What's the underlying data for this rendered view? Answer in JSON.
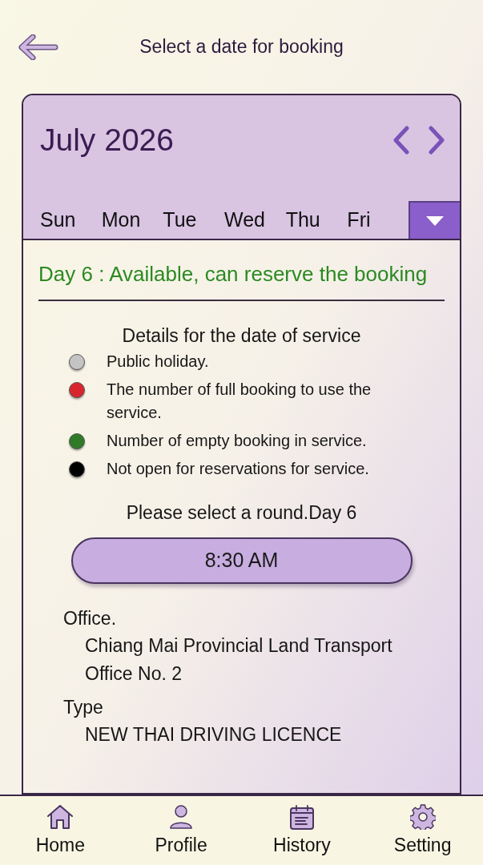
{
  "header": {
    "title": "Select a date for booking"
  },
  "calendar": {
    "month": "July 2026",
    "weekdays": [
      "Sun",
      "Mon",
      "Tue",
      "Wed",
      "Thu",
      "Fri"
    ]
  },
  "status": "Day 6 : Available, can reserve the booking",
  "legend": {
    "title": "Details for the date of service",
    "items": [
      {
        "label": "Public holiday.",
        "color": "#c4c4c4"
      },
      {
        "label": "The number of full booking to use the service.",
        "color": "#d8262e"
      },
      {
        "label": "Number of empty booking in service.",
        "color": "#2e7a26"
      },
      {
        "label": "Not open for reservations for service.",
        "color": "#000000"
      }
    ]
  },
  "rounds": {
    "title": "Please select a round.Day 6",
    "slots": [
      {
        "time": "8:30 AM"
      }
    ]
  },
  "details": [
    {
      "label": "Office.",
      "value": "Chiang Mai Provincial Land Transport Office No. 2"
    },
    {
      "label": "Type",
      "value": "NEW THAI DRIVING LICENCE"
    }
  ],
  "nav": [
    {
      "label": "Home",
      "kind": "home"
    },
    {
      "label": "Profile",
      "kind": "profile"
    },
    {
      "label": "History",
      "kind": "history"
    },
    {
      "label": "Setting",
      "kind": "setting"
    }
  ]
}
